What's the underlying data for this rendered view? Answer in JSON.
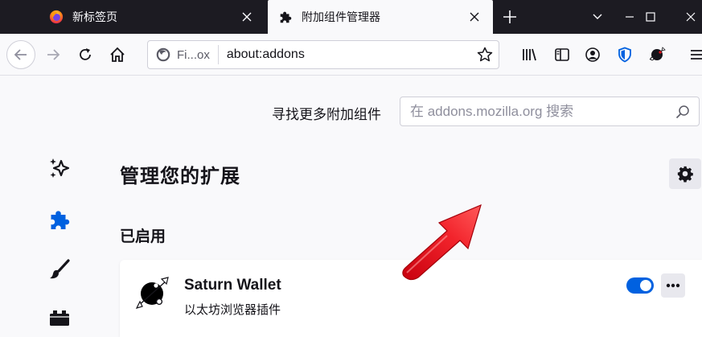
{
  "tabs": [
    {
      "title": "新标签页",
      "icon": "firefox-logo-icon",
      "active": false
    },
    {
      "title": "附加组件管理器",
      "icon": "puzzle-piece-icon",
      "active": true
    }
  ],
  "toolbar": {
    "identity_label": "Fi...ox",
    "url": "about:addons"
  },
  "page": {
    "find_more_label": "寻找更多附加组件",
    "search_placeholder": "在 addons.mozilla.org 搜索",
    "heading": "管理您的扩展",
    "section_enabled": "已启用"
  },
  "categories": [
    {
      "icon": "sparkle-recommendations-icon",
      "selected": false
    },
    {
      "icon": "puzzle-extensions-icon",
      "selected": true
    },
    {
      "icon": "brush-themes-icon",
      "selected": false
    },
    {
      "icon": "plugin-block-icon",
      "selected": false
    }
  ],
  "extension": {
    "name": "Saturn Wallet",
    "description": "以太坊浏览器插件",
    "enabled": true
  },
  "colors": {
    "accent": "#0061e0",
    "tab_strip": "#1c1b22",
    "annotation_arrow": "#e0121b"
  }
}
